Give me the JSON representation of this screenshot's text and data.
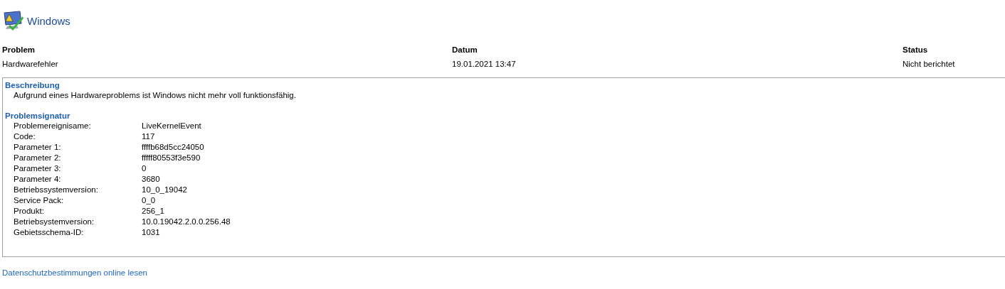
{
  "header": {
    "title": "Windows"
  },
  "table": {
    "columns": [
      "Problem",
      "Datum",
      "Status"
    ],
    "rows": [
      [
        "Hardwarefehler",
        "19.01.2021 13:47",
        "Nicht berichtet"
      ]
    ]
  },
  "details": {
    "description_heading": "Beschreibung",
    "description": "Aufgrund eines Hardwareproblems ist Windows nicht mehr voll funktionsfähig.",
    "signature_heading": "Problemsignatur",
    "signature": [
      {
        "label": "Problemereignisame:",
        "value": "LiveKernelEvent"
      },
      {
        "label": "Code:",
        "value": "117"
      },
      {
        "label": "Parameter 1:",
        "value": "ffffb68d5cc24050"
      },
      {
        "label": "Parameter 2:",
        "value": "fffff80553f3e590"
      },
      {
        "label": "Parameter 3:",
        "value": "0"
      },
      {
        "label": "Parameter 4:",
        "value": "3680"
      },
      {
        "label": "Betriebssystemversion:",
        "value": "10_0_19042"
      },
      {
        "label": "Service Pack:",
        "value": "0_0"
      },
      {
        "label": "Produkt:",
        "value": "256_1"
      },
      {
        "label": "Betriebsystemversion:",
        "value": "10.0.19042.2.0.0.256.48"
      },
      {
        "label": "Gebietsschema-ID:",
        "value": "1031"
      }
    ]
  },
  "footer_link": "Datenschutzbestimmungen online lesen"
}
